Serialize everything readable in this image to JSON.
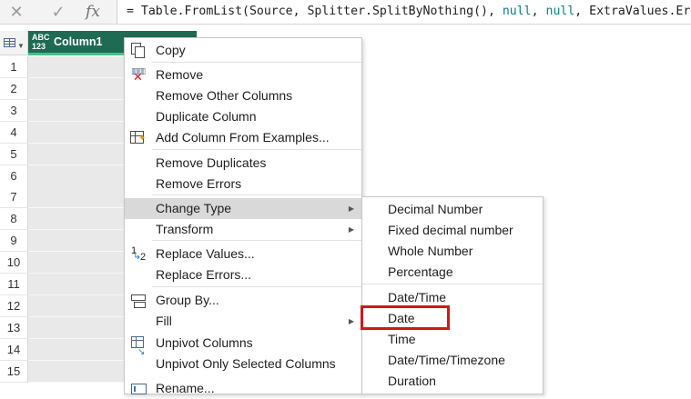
{
  "formula_bar": {
    "cancel_icon": "close-icon",
    "commit_icon": "check-icon",
    "fx_label": "fx",
    "formula_parts": [
      {
        "text": "= Table.FromList(Source, Splitter.SplitByNothing(), ",
        "kw": false
      },
      {
        "text": "null",
        "kw": true
      },
      {
        "text": ", ",
        "kw": false
      },
      {
        "text": "null",
        "kw": true
      },
      {
        "text": ", ExtraValues.Error)",
        "kw": false
      }
    ]
  },
  "grid": {
    "type_badge_top": "ABC",
    "type_badge_bottom": "123",
    "column_name": "Column1",
    "row_numbers": [
      "1",
      "2",
      "3",
      "4",
      "5",
      "6",
      "7",
      "8",
      "9",
      "10",
      "11",
      "12",
      "13",
      "14",
      "15"
    ]
  },
  "context_menu": {
    "items": [
      {
        "label": "Copy",
        "icon": "copy-icon",
        "submenu": false
      },
      {
        "label": "Remove",
        "icon": "remove-column-icon",
        "submenu": false
      },
      {
        "label": "Remove Other Columns",
        "icon": "",
        "submenu": false
      },
      {
        "label": "Duplicate Column",
        "icon": "",
        "submenu": false
      },
      {
        "label": "Add Column From Examples...",
        "icon": "column-from-examples-icon",
        "submenu": false
      },
      {
        "label": "Remove Duplicates",
        "icon": "",
        "submenu": false
      },
      {
        "label": "Remove Errors",
        "icon": "",
        "submenu": false
      },
      {
        "label": "Change Type",
        "icon": "",
        "submenu": true,
        "active": true
      },
      {
        "label": "Transform",
        "icon": "",
        "submenu": true
      },
      {
        "label": "Replace Values...",
        "icon": "replace-values-icon",
        "submenu": false
      },
      {
        "label": "Replace Errors...",
        "icon": "",
        "submenu": false
      },
      {
        "label": "Group By...",
        "icon": "group-by-icon",
        "submenu": false
      },
      {
        "label": "Fill",
        "icon": "",
        "submenu": true
      },
      {
        "label": "Unpivot Columns",
        "icon": "unpivot-columns-icon",
        "submenu": false
      },
      {
        "label": "Unpivot Only Selected Columns",
        "icon": "",
        "submenu": false
      },
      {
        "label": "Rename...",
        "icon": "rename-icon",
        "submenu": false
      }
    ]
  },
  "change_type_submenu": {
    "items": [
      {
        "label": "Decimal Number"
      },
      {
        "label": "Fixed decimal number"
      },
      {
        "label": "Whole Number"
      },
      {
        "label": "Percentage"
      },
      {
        "label": "Date/Time"
      },
      {
        "label": "Date",
        "highlighted": true
      },
      {
        "label": "Time"
      },
      {
        "label": "Date/Time/Timezone"
      },
      {
        "label": "Duration"
      }
    ]
  },
  "colors": {
    "column_header_bg": "#1f6a52",
    "column_header_underline": "#45c18a",
    "highlight_box": "#d0171e",
    "active_menu_bg": "#d9d9d9"
  }
}
